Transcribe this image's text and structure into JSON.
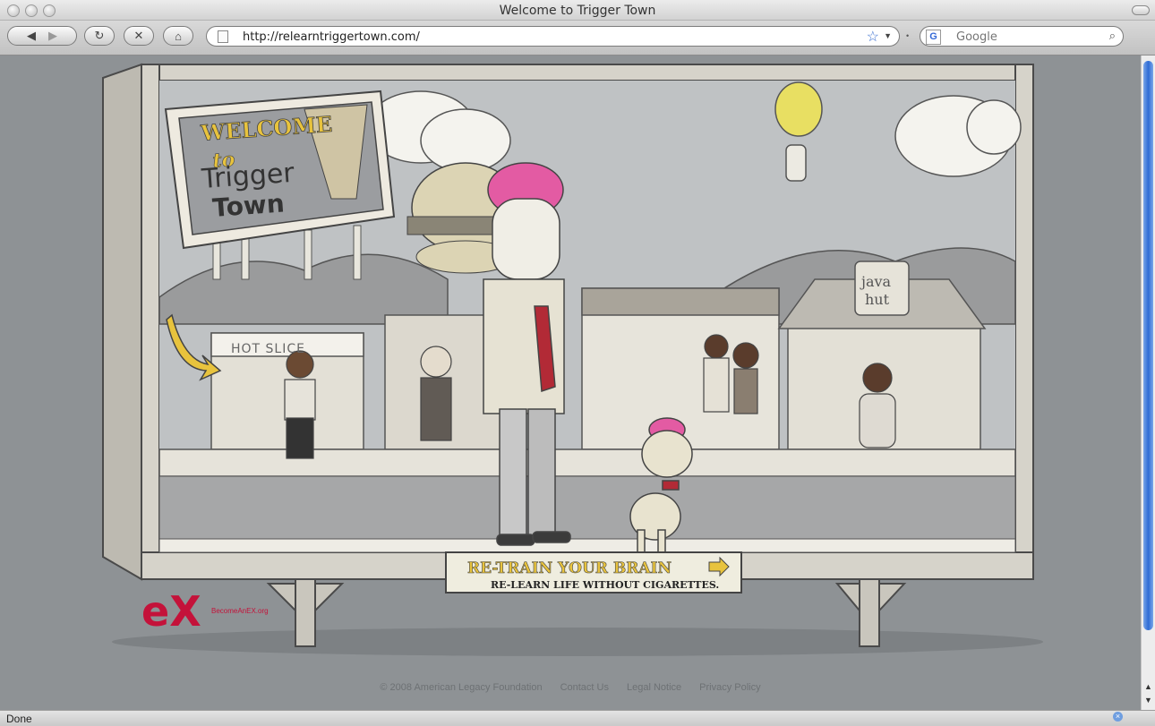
{
  "window": {
    "title": "Welcome to Trigger Town"
  },
  "toolbar": {
    "url": "http://relearntriggertown.com/",
    "search_placeholder": "Google"
  },
  "billboard": {
    "welcome_line1": "WELCOME",
    "welcome_line2": "to",
    "welcome_line3": "Trigger",
    "welcome_line4": "Town",
    "shop_hot_slice": "HOT SLICE",
    "shop_java_line1": "java",
    "shop_java_line2": "hut",
    "cta_line1": "RE-TRAIN YOUR BRAIN",
    "cta_line2": "RE-LEARN LIFE WITHOUT CIGARETTES."
  },
  "logo": {
    "mark": "eX",
    "site": "BecomeAnEX.org"
  },
  "footer": {
    "copyright": "© 2008 American Legacy Foundation",
    "links": [
      "Contact Us",
      "Legal Notice",
      "Privacy Policy"
    ]
  },
  "status": {
    "text": "Done"
  },
  "colors": {
    "brand_red": "#c4123a",
    "cta_yellow": "#e8c33d",
    "pink_brain": "#e35ba3"
  }
}
